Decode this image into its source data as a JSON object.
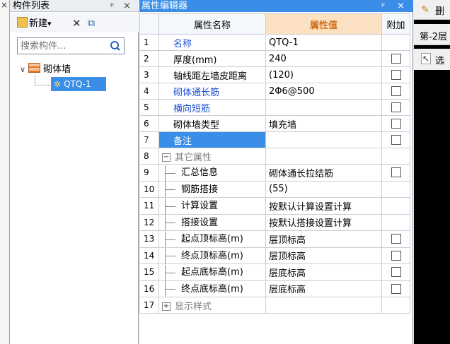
{
  "left_strip": {
    "close_glyph": "×"
  },
  "component_list": {
    "title": "构件列表",
    "pin_glyph": "ᵖ",
    "close_glyph": "×",
    "toolbar": {
      "new_label": "新建",
      "new_arrow": "▾",
      "delete_glyph": "✕",
      "copy_glyph": "⧉"
    },
    "search": {
      "placeholder": "搜索构件...",
      "value": ""
    },
    "tree": {
      "root": {
        "label": "砌体墙",
        "expand_glyph": "∨"
      },
      "children": [
        {
          "label": "QTQ-1",
          "selected": true
        }
      ]
    }
  },
  "property_editor": {
    "title": "属性编辑器",
    "pin_glyph": "ᵖ",
    "close_glyph": "×",
    "headers": {
      "name": "属性名称",
      "value": "属性值",
      "extra": "附加"
    },
    "rows": [
      {
        "num": "1",
        "name": "名称",
        "value": "QTQ-1",
        "blue": true,
        "checkbox": false
      },
      {
        "num": "2",
        "name": "厚度(mm)",
        "value": "240",
        "blue": false,
        "checkbox": true
      },
      {
        "num": "3",
        "name": "轴线距左墙皮距离",
        "value": "(120)",
        "blue": false,
        "checkbox": true
      },
      {
        "num": "4",
        "name": "砌体通长筋",
        "value": "2Φ6@500",
        "blue": true,
        "checkbox": true
      },
      {
        "num": "5",
        "name": "横向短筋",
        "value": "",
        "blue": true,
        "checkbox": true
      },
      {
        "num": "6",
        "name": "砌体墙类型",
        "value": "填充墙",
        "blue": false,
        "checkbox": true
      },
      {
        "num": "7",
        "name": "备注",
        "value": "",
        "blue": false,
        "checkbox": true,
        "selected": true
      },
      {
        "num": "8",
        "name": "其它属性",
        "value": "",
        "group": true,
        "expander": "−"
      },
      {
        "num": "9",
        "name": "汇总信息",
        "value": "砌体通长拉结筋",
        "child": true,
        "checkbox": true
      },
      {
        "num": "10",
        "name": "钢筋搭接",
        "value": "(55)",
        "child": true,
        "checkbox": false
      },
      {
        "num": "11",
        "name": "计算设置",
        "value": "按默认计算设置计算",
        "child": true,
        "checkbox": false
      },
      {
        "num": "12",
        "name": "搭接设置",
        "value": "按默认搭接设置计算",
        "child": true,
        "checkbox": false
      },
      {
        "num": "13",
        "name": "起点顶标高(m)",
        "value": "层顶标高",
        "child": true,
        "checkbox": true
      },
      {
        "num": "14",
        "name": "终点顶标高(m)",
        "value": "层顶标高",
        "child": true,
        "checkbox": true
      },
      {
        "num": "15",
        "name": "起点底标高(m)",
        "value": "层底标高",
        "child": true,
        "checkbox": true
      },
      {
        "num": "16",
        "name": "终点底标高(m)",
        "value": "层底标高",
        "child": true,
        "checkbox": true
      },
      {
        "num": "17",
        "name": "显示样式",
        "value": "",
        "group": true,
        "expander": "+"
      }
    ]
  },
  "right_panel": {
    "row1_text": "删",
    "row2_text": "第-2层",
    "row3_text": "选"
  },
  "colors": {
    "title_blue": "#3a8ee8",
    "header_value_bg": "#fbe0c2",
    "header_value_text": "#d0701a",
    "link_blue": "#1e50d8"
  }
}
